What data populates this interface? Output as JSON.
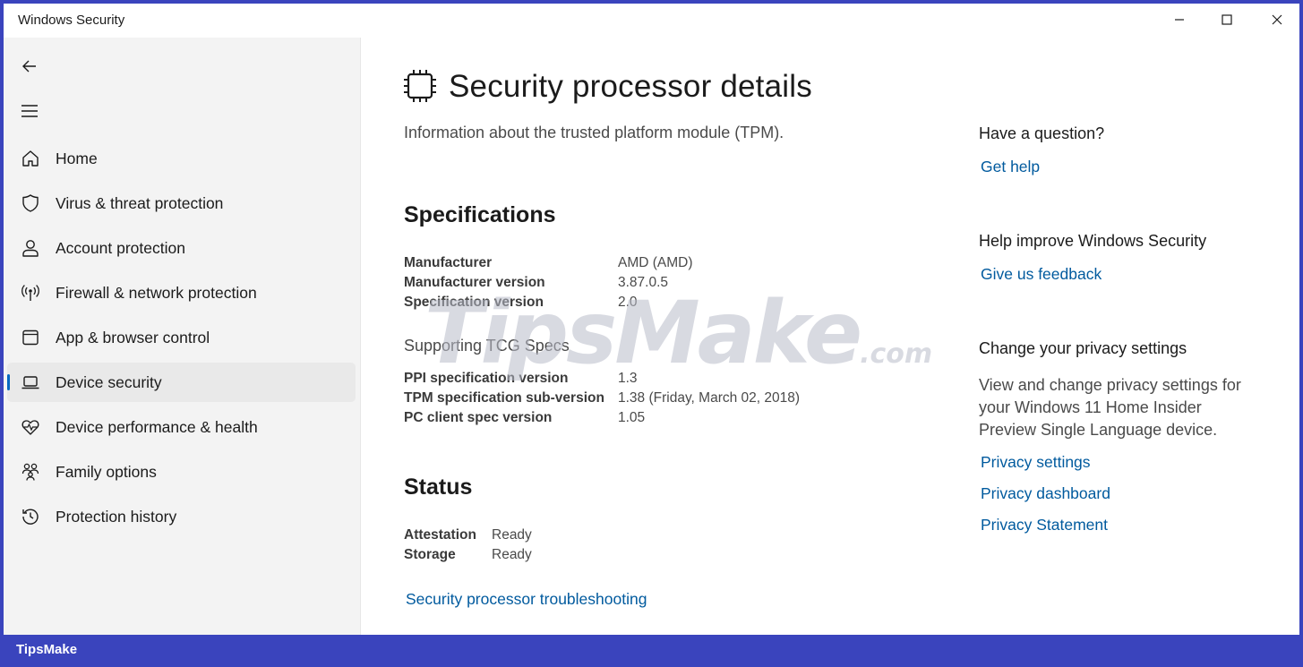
{
  "window": {
    "title": "Windows Security"
  },
  "titlebar_buttons": {
    "minimize_icon": "minimize-icon",
    "maximize_icon": "maximize-icon",
    "close_icon": "close-icon"
  },
  "sidebar": {
    "back_icon": "back-arrow-icon",
    "menu_icon": "hamburger-menu-icon",
    "items": [
      {
        "label": "Home",
        "icon": "home-icon",
        "selected": false
      },
      {
        "label": "Virus & threat protection",
        "icon": "shield-icon",
        "selected": false
      },
      {
        "label": "Account protection",
        "icon": "person-icon",
        "selected": false
      },
      {
        "label": "Firewall & network protection",
        "icon": "antenna-icon",
        "selected": false
      },
      {
        "label": "App & browser control",
        "icon": "app-window-icon",
        "selected": false
      },
      {
        "label": "Device security",
        "icon": "laptop-icon",
        "selected": true
      },
      {
        "label": "Device performance & health",
        "icon": "heart-pulse-icon",
        "selected": false
      },
      {
        "label": "Family options",
        "icon": "family-icon",
        "selected": false
      },
      {
        "label": "Protection history",
        "icon": "history-icon",
        "selected": false
      }
    ]
  },
  "main": {
    "title": "Security processor details",
    "title_icon": "chip-icon",
    "subtitle": "Information about the trusted platform module (TPM).",
    "specifications": {
      "heading": "Specifications",
      "rows": [
        {
          "label": "Manufacturer",
          "value": "AMD (AMD)"
        },
        {
          "label": "Manufacturer version",
          "value": "3.87.0.5"
        },
        {
          "label": "Specification version",
          "value": "2.0"
        }
      ],
      "tcg_heading": "Supporting TCG Specs",
      "tcg_rows": [
        {
          "label": "PPI specification version",
          "value": "1.3"
        },
        {
          "label": "TPM specification sub-version",
          "value": "1.38 (Friday, March 02, 2018)"
        },
        {
          "label": "PC client spec version",
          "value": "1.05"
        }
      ]
    },
    "status": {
      "heading": "Status",
      "rows": [
        {
          "label": "Attestation",
          "value": "Ready"
        },
        {
          "label": "Storage",
          "value": "Ready"
        }
      ],
      "troubleshoot_link": "Security processor troubleshooting"
    }
  },
  "right_panel": {
    "question": {
      "heading": "Have a question?",
      "link": "Get help"
    },
    "improve": {
      "heading": "Help improve Windows Security",
      "link": "Give us feedback"
    },
    "privacy": {
      "heading": "Change your privacy settings",
      "text": "View and change privacy settings for your Windows 11 Home Insider Preview Single Language device.",
      "links": [
        "Privacy settings",
        "Privacy dashboard",
        "Privacy Statement"
      ]
    }
  },
  "watermark": {
    "text": "TipsMake",
    "suffix": ".com"
  },
  "footer": {
    "brand": "TipsMake"
  },
  "colors": {
    "accent": "#0067c0",
    "link": "#005a9e",
    "frame": "#3a44bd",
    "sidebar_bg": "#f3f3f3"
  }
}
